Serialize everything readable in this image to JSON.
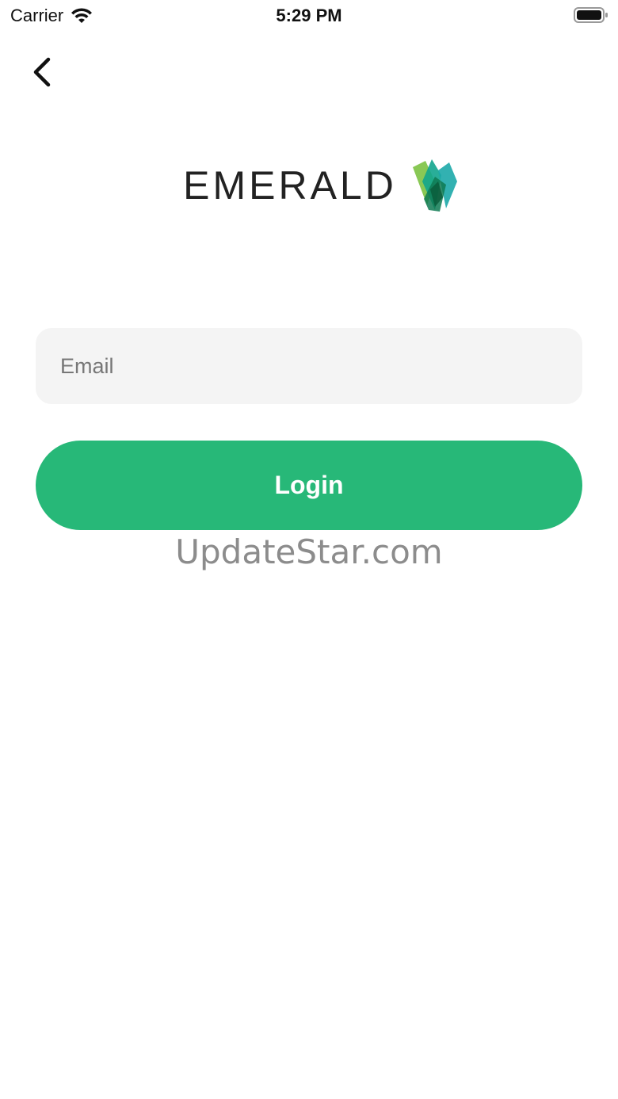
{
  "status_bar": {
    "carrier": "Carrier",
    "time": "5:29 PM",
    "wifi_icon": "wifi-icon",
    "battery_icon": "battery-icon"
  },
  "nav": {
    "back_icon": "chevron-left-icon"
  },
  "logo": {
    "text": "EMERALD",
    "mark_icon": "emerald-crystal-icon",
    "colors": {
      "green": "#7cc242",
      "teal": "#1aa89a",
      "dark": "#0d6e4f"
    }
  },
  "form": {
    "email_value": "",
    "email_placeholder": "Email",
    "login_label": "Login"
  },
  "watermark": "UpdateStar.com",
  "colors": {
    "accent": "#27b878",
    "field_bg": "#f4f4f4",
    "background": "#ffffff"
  }
}
